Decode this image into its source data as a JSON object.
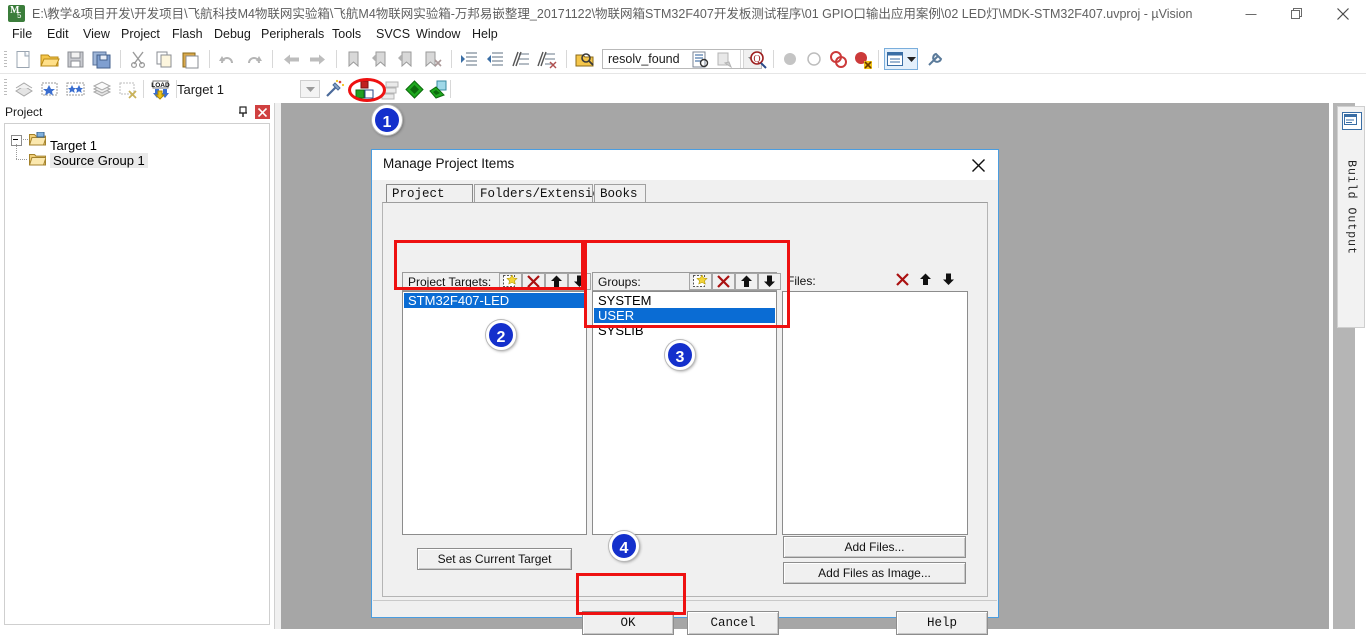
{
  "window": {
    "title": "E:\\教学&项目开发\\开发项目\\飞航科技M4物联网实验箱\\飞航M4物联网实验箱-万邦易嵌整理_20171122\\物联网箱STM32F407开发板测试程序\\01 GPIO口输出应用案例\\02 LED灯\\MDK-STM32F407.uvproj - µVision",
    "logo_text": "μV",
    "minimize_label": "Minimize",
    "maximize_label": "Maximize",
    "close_label": "Close"
  },
  "menu": {
    "items": [
      {
        "label": "File"
      },
      {
        "label": "Edit"
      },
      {
        "label": "View"
      },
      {
        "label": "Project"
      },
      {
        "label": "Flash"
      },
      {
        "label": "Debug"
      },
      {
        "label": "Peripherals"
      },
      {
        "label": "Tools"
      },
      {
        "label": "SVCS"
      },
      {
        "label": "Window"
      },
      {
        "label": "Help"
      }
    ]
  },
  "toolbar_main": {
    "icons": [
      {
        "name": "new-file-icon"
      },
      {
        "name": "open-file-icon"
      },
      {
        "name": "save-icon"
      },
      {
        "name": "save-all-icon"
      },
      {
        "name": "cut-icon"
      },
      {
        "name": "copy-icon"
      },
      {
        "name": "paste-icon"
      },
      {
        "name": "undo-icon"
      },
      {
        "name": "redo-icon"
      },
      {
        "name": "navigate-back-icon"
      },
      {
        "name": "navigate-forward-icon"
      },
      {
        "name": "bookmark-toggle-icon"
      },
      {
        "name": "bookmark-prev-icon"
      },
      {
        "name": "bookmark-next-icon"
      },
      {
        "name": "bookmark-clear-icon"
      },
      {
        "name": "indent-icon"
      },
      {
        "name": "outdent-icon"
      },
      {
        "name": "comment-icon"
      },
      {
        "name": "uncomment-icon"
      },
      {
        "name": "find-in-files-icon"
      }
    ],
    "search_value": "resolv_found",
    "search_placeholder": "",
    "extra_icons": [
      {
        "name": "find-in-files-list-icon"
      },
      {
        "name": "incremental-find-icon"
      },
      {
        "name": "find-icon"
      },
      {
        "name": "breakpoint-icon"
      },
      {
        "name": "breakpoint-disable-icon"
      },
      {
        "name": "breakpoint-kill-all-icon"
      },
      {
        "name": "breakpoint-disable-all-icon"
      },
      {
        "name": "window-layout-icon"
      },
      {
        "name": "configure-toolbar-icon"
      }
    ]
  },
  "toolbar_build": {
    "icons": [
      {
        "name": "translate-icon"
      },
      {
        "name": "build-icon"
      },
      {
        "name": "rebuild-all-icon"
      },
      {
        "name": "batch-build-icon"
      },
      {
        "name": "stop-build-icon"
      },
      {
        "name": "download-to-flash-icon"
      }
    ],
    "target_value": "Target 1",
    "after_icons": [
      {
        "name": "target-dropdown-icon"
      },
      {
        "name": "options-for-target-icon"
      },
      {
        "name": "manage-project-items-icon"
      },
      {
        "name": "manage-multi-project-icon"
      },
      {
        "name": "pack-installer-icon"
      },
      {
        "name": "manage-run-time-env-icon"
      }
    ]
  },
  "project_dock": {
    "title": "Project",
    "pin_label": "Auto Hide",
    "close_label": "Close",
    "tree": [
      {
        "label": "Target 1",
        "icon": "project-target-folder-icon",
        "level": 0,
        "expanded": true
      },
      {
        "label": "Source Group 1",
        "icon": "source-group-folder-icon",
        "level": 1,
        "expanded": false,
        "selected": true
      }
    ]
  },
  "right_dock": {
    "tab_label": "Build Output",
    "tab_icon": "build-output-icon"
  },
  "dialog": {
    "title": "Manage Project Items",
    "close_label": "Close",
    "tabs": [
      {
        "label": "Project Items",
        "active": true
      },
      {
        "label": "Folders/Extensions",
        "active": false
      },
      {
        "label": "Books",
        "active": false
      }
    ],
    "columns": {
      "targets": {
        "header": "Project Targets:",
        "buttons": [
          {
            "name": "new-target-icon"
          },
          {
            "name": "delete-target-icon"
          },
          {
            "name": "move-target-up-icon"
          },
          {
            "name": "move-target-down-icon"
          }
        ],
        "items": [
          {
            "label": "STM32F407-LED",
            "selected": true
          }
        ]
      },
      "groups": {
        "header": "Groups:",
        "buttons": [
          {
            "name": "new-group-icon"
          },
          {
            "name": "delete-group-icon"
          },
          {
            "name": "move-group-up-icon"
          },
          {
            "name": "move-group-down-icon"
          }
        ],
        "items": [
          {
            "label": "SYSTEM",
            "selected": false
          },
          {
            "label": "USER",
            "selected": true
          },
          {
            "label": "SYSLIB",
            "selected": false
          }
        ]
      },
      "files": {
        "header": "Files:",
        "buttons": [
          {
            "name": "delete-file-icon"
          },
          {
            "name": "move-file-up-icon"
          },
          {
            "name": "move-file-down-icon"
          }
        ],
        "items": []
      }
    },
    "buttons": {
      "set_current_target": "Set as Current Target",
      "add_files": "Add Files...",
      "add_files_as_image": "Add Files as Image...",
      "ok": "OK",
      "cancel": "Cancel",
      "help": "Help"
    }
  },
  "annotations": {
    "badges": [
      {
        "number": "1"
      },
      {
        "number": "2"
      },
      {
        "number": "3"
      },
      {
        "number": "4"
      }
    ],
    "highlight_color": "#ee1111",
    "badge_color": "#1430cc"
  }
}
